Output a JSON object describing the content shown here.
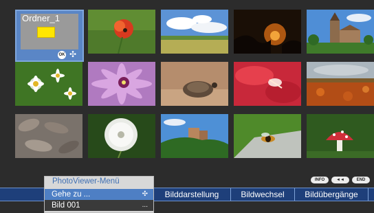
{
  "folder": {
    "label": "Ordner_1",
    "ok_icon": "ok-button-icon",
    "arrows_icon": "four-way-arrows-icon"
  },
  "thumbnails": [
    "red-poppy",
    "cloudy-sky-field",
    "sunset-silhouette",
    "castle-church",
    "white-daisies",
    "purple-flower",
    "sandy-shell",
    "red-flower",
    "autumn-field",
    "dry-leaves",
    "dandelion-seedhead",
    "hill-castle",
    "bee-on-rock",
    "red-mushroom"
  ],
  "key_hints": [
    "INFO",
    "◄◄",
    "END"
  ],
  "menu_bar": {
    "items": [
      "Bilddarstellung",
      "Bildwechsel",
      "Bildübergänge"
    ]
  },
  "popup_menu": {
    "title": "PhotoViewer-Menü",
    "items": [
      {
        "label": "Gehe zu ...",
        "right": "✣",
        "selected": true
      },
      {
        "label": "Bild 001",
        "right": "...",
        "selected": false
      }
    ]
  },
  "colors": {
    "background": "#2c2c2c",
    "menubar": "#1e3f7a",
    "selection": "#4e7fc4",
    "folder_icon": "#ffe600"
  }
}
